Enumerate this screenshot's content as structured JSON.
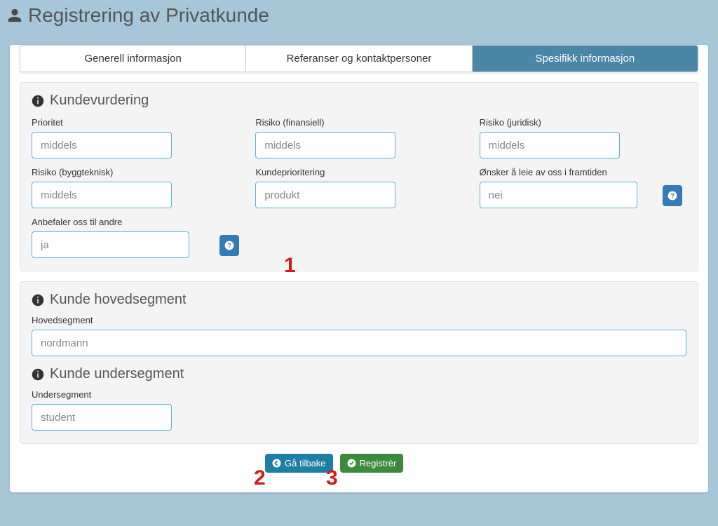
{
  "header": {
    "title": "Registrering av Privatkunde"
  },
  "tabs": {
    "general": "Generell informasjon",
    "refs": "Referanser og kontaktpersoner",
    "specific": "Spesifikk informasjon"
  },
  "assessment": {
    "title": "Kundevurdering",
    "priority": {
      "label": "Prioritet",
      "value": "middels"
    },
    "risk_fin": {
      "label": "Risiko (finansiell)",
      "value": "middels"
    },
    "risk_legal": {
      "label": "Risiko (juridisk)",
      "value": "middels"
    },
    "risk_build": {
      "label": "Risiko (byggteknisk)",
      "value": "middels"
    },
    "cust_priority": {
      "label": "Kundeprioritering",
      "value": "produkt"
    },
    "future_rent": {
      "label": "Ønsker å leie av oss i framtiden",
      "value": "nei"
    },
    "recommends": {
      "label": "Anbefaler oss til andre",
      "value": "ja"
    }
  },
  "main_segment": {
    "title": "Kunde hovedsegment",
    "field": {
      "label": "Hovedsegment",
      "value": "nordmann"
    }
  },
  "sub_segment": {
    "title": "Kunde undersegment",
    "field": {
      "label": "Undersegment",
      "value": "student"
    }
  },
  "buttons": {
    "back": "Gå tilbake",
    "register": "Registrèr"
  },
  "annotations": {
    "one": "1",
    "two": "2",
    "three": "3"
  }
}
